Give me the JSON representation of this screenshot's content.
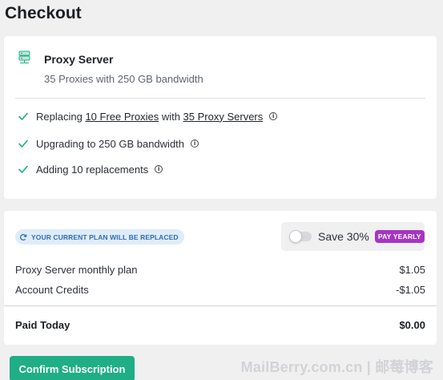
{
  "page": {
    "title": "Checkout"
  },
  "product": {
    "icon": "server-icon",
    "name": "Proxy Server",
    "description": "35 Proxies with 250 GB bandwidth"
  },
  "features": [
    {
      "prefix": "Replacing ",
      "link1": "10 Free Proxies",
      "middle": " with ",
      "link2": "35 Proxy Servers"
    },
    {
      "text": "Upgrading to 250 GB bandwidth"
    },
    {
      "text": "Adding 10 replacements"
    }
  ],
  "plan_notice": "YOUR CURRENT PLAN WILL BE REPLACED",
  "billing": {
    "save_label": "Save 30%",
    "pay_yearly_label": "PAY YEARLY",
    "toggle_on": false
  },
  "lines": [
    {
      "label": "Proxy Server monthly plan",
      "amount": "$1.05"
    },
    {
      "label": "Account Credits",
      "amount": "-$1.05"
    }
  ],
  "total": {
    "label": "Paid Today",
    "amount": "$0.00"
  },
  "confirm_label": "Confirm Subscription",
  "watermark": "MailBerry.com.cn | 邮莓博客",
  "colors": {
    "accent": "#1fae86",
    "check": "#1fae86",
    "badge_bg": "#dfecfa",
    "badge_text": "#2f6fb3",
    "pay_yearly": "#a436c2"
  }
}
